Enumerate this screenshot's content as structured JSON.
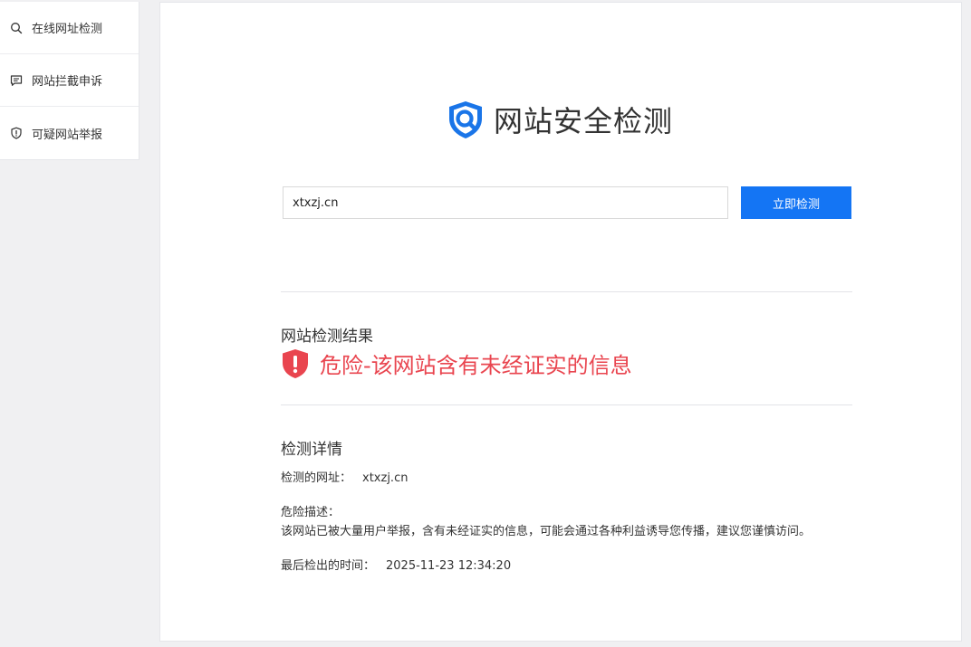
{
  "sidebar": {
    "items": [
      {
        "label": "在线网址检测",
        "icon": "search-icon"
      },
      {
        "label": "网站拦截申诉",
        "icon": "message-icon"
      },
      {
        "label": "可疑网站举报",
        "icon": "shield-alert-icon"
      }
    ]
  },
  "header": {
    "title": "网站安全检测",
    "logo_icon": "shield-search-icon"
  },
  "search": {
    "value": "xtxzj.cn",
    "button_label": "立即检测"
  },
  "result": {
    "section_title": "网站检测结果",
    "status_text": "危险-该网站含有未经证实的信息",
    "status_icon": "danger-exclamation-icon"
  },
  "details": {
    "section_title": "检测详情",
    "url_label": "检测的网址：",
    "url_value": "xtxzj.cn",
    "risk_label": "危险描述：",
    "risk_description": "该网站已被大量用户举报，含有未经证实的信息，可能会通过各种利益诱导您传播，建议您谨慎访问。",
    "time_label": "最后检出的时间：",
    "time_value": "2025-11-23 12:34:20"
  },
  "colors": {
    "accent": "#1475f4",
    "danger": "#e9454f",
    "logo_blue": "#1a75e8"
  }
}
